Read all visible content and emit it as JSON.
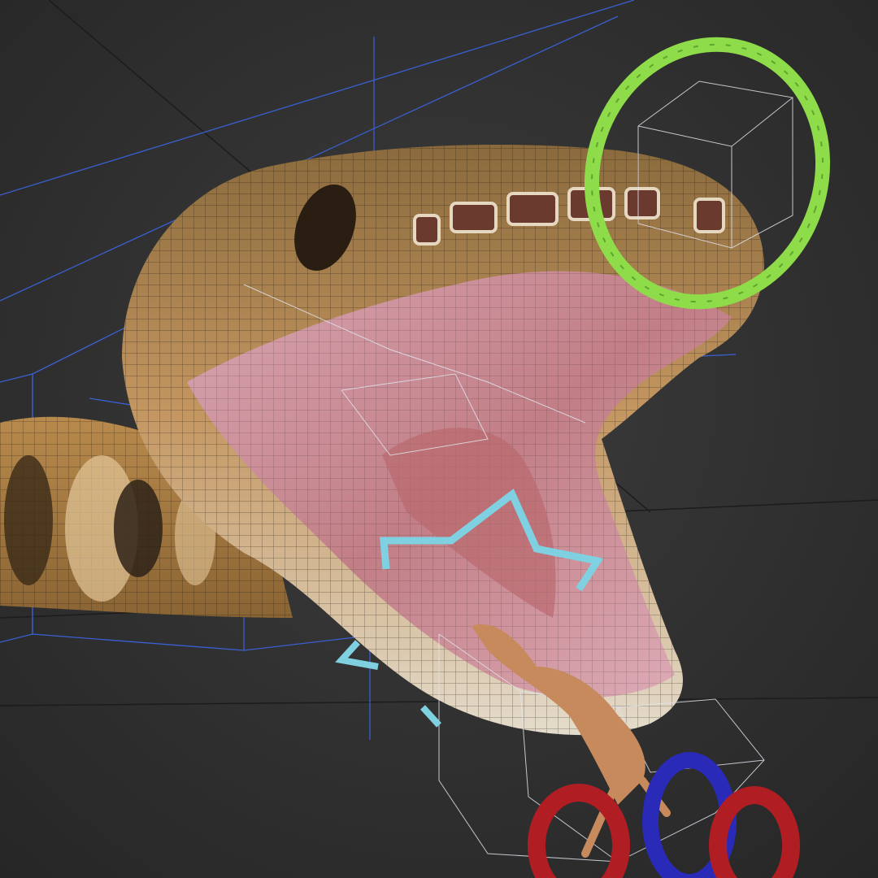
{
  "viewport": {
    "background_color": "#353535",
    "grid_color": "#1e1e1e",
    "bounding_box_color": "#3a5fd0",
    "lattice_color": "#d8dce8"
  },
  "rig_controls": {
    "head_ring_color": "#8fdc4a",
    "jaw_control_color": "#7fd0e0",
    "tongue_ring_left_color": "#b01e24",
    "tongue_ring_middle_color": "#2a2ab8",
    "tongue_ring_right_color": "#b01e24"
  },
  "model": {
    "skin_color": "#b7884e",
    "belly_color": "#e2d8c4",
    "mouth_color": "#c98a93",
    "tongue_color": "#c98a5e"
  }
}
